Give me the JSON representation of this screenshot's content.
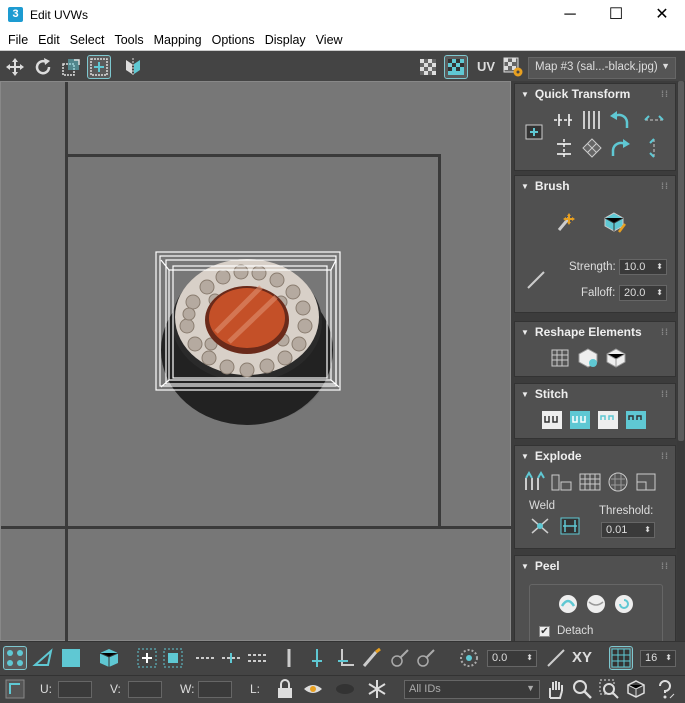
{
  "window": {
    "title": "Edit UVWs",
    "icon_letter": "3",
    "minimize": "─",
    "maximize": "☐",
    "close": "✕"
  },
  "menu": [
    "File",
    "Edit",
    "Select",
    "Tools",
    "Mapping",
    "Options",
    "Display",
    "View"
  ],
  "toolbar": {
    "uv_label": "UV",
    "map_select": "Map #3 (sal...-black.jpg)"
  },
  "panel": {
    "quick_transform": {
      "title": "Quick Transform"
    },
    "brush": {
      "title": "Brush",
      "strength_label": "Strength:",
      "strength_value": "10.0",
      "falloff_label": "Falloff:",
      "falloff_value": "20.0"
    },
    "reshape": {
      "title": "Reshape Elements"
    },
    "stitch": {
      "title": "Stitch"
    },
    "explode": {
      "title": "Explode",
      "weld_label": "Weld",
      "threshold_label": "Threshold:",
      "threshold_value": "0.01"
    },
    "peel": {
      "title": "Peel",
      "detach_label": "Detach",
      "detach_checked": true
    }
  },
  "bottom": {
    "angle_value": "0.0",
    "xy_label": "XY",
    "grid_value": "16",
    "u_label": "U:",
    "v_label": "V:",
    "w_label": "W:",
    "l_label": "L:",
    "ids_select": "All IDs"
  },
  "colors": {
    "accent": "#5fc8d3",
    "panel": "#505050",
    "viewport": "#777777"
  }
}
